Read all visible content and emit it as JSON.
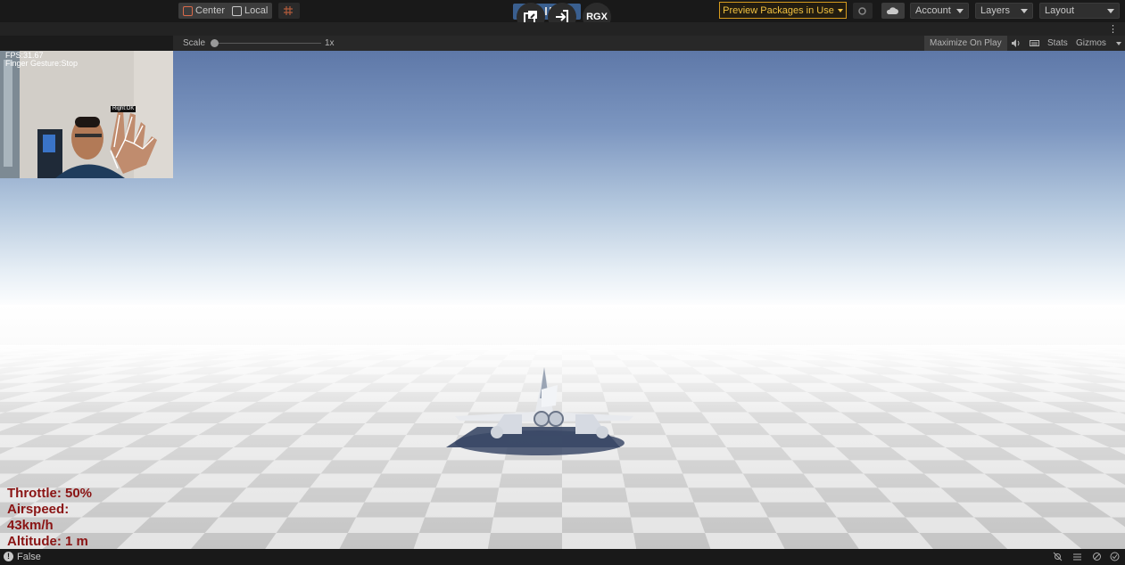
{
  "toolbar": {
    "pivot_label": "Center",
    "space_label": "Local",
    "preview_packages_label": "Preview Packages in Use",
    "account_label": "Account",
    "layers_label": "Layers",
    "layout_label": "Layout",
    "overlay_badge_label": "RGX"
  },
  "game_view": {
    "scale_label": "Scale",
    "scale_value": "1x",
    "maximize_label": "Maximize On Play",
    "stats_label": "Stats",
    "gizmos_label": "Gizmos"
  },
  "webcam": {
    "fps_text": "FPS:31.67",
    "gesture_text": "Finger Gesture:Stop",
    "hand_label": "Right:OK"
  },
  "hud": {
    "throttle": "Throttle: 50%",
    "airspeed_label": "Airspeed:",
    "airspeed_value": "43km/h",
    "altitude": "Altitude: 1 m"
  },
  "status_bar": {
    "message": "False"
  },
  "colors": {
    "hud_text": "#8a1414",
    "preview_accent": "#f0c040",
    "play_button": "#3a5f8f"
  }
}
